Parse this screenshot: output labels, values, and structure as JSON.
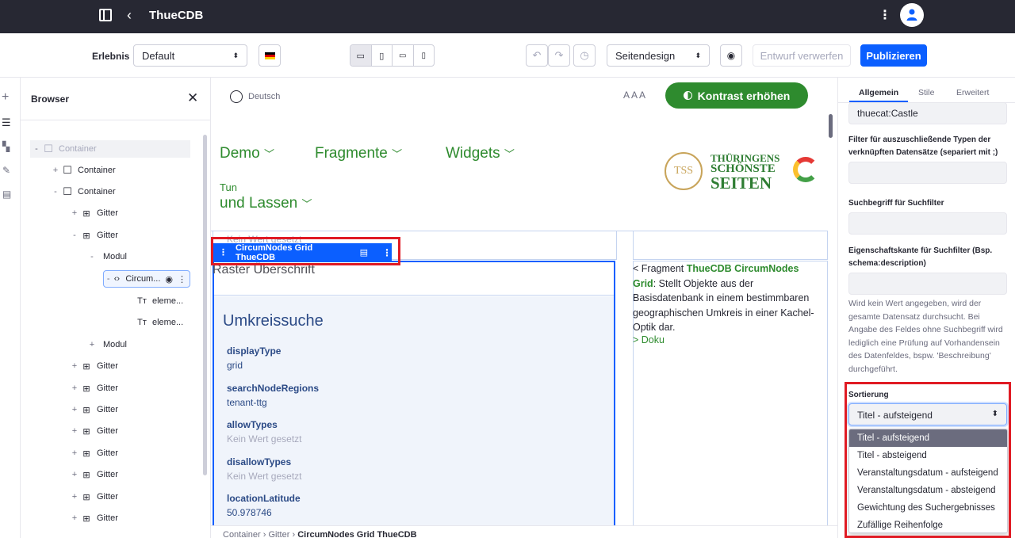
{
  "topbar": {
    "title": "ThueCDB"
  },
  "toolbar": {
    "experience_label": "Erlebnis",
    "experience_value": "Default",
    "design_value": "Seitendesign",
    "discard_label": "Entwurf verwerfen",
    "publish_label": "Publizieren"
  },
  "browser": {
    "title": "Browser",
    "items": [
      {
        "toggle": "-",
        "icon": "container-icon",
        "label": "Container"
      },
      {
        "toggle": "+",
        "icon": "container-icon",
        "label": "Container"
      },
      {
        "toggle": "-",
        "icon": "container-icon",
        "label": "Container"
      },
      {
        "toggle": "+",
        "icon": "grid-icon",
        "label": "Gitter"
      },
      {
        "toggle": "-",
        "icon": "grid-icon",
        "label": "Gitter"
      },
      {
        "toggle": "-",
        "icon": "",
        "label": "Modul"
      },
      {
        "toggle": "-",
        "icon": "code-icon",
        "label": "Circum..."
      },
      {
        "toggle": "",
        "icon": "text-icon",
        "label": "eleme..."
      },
      {
        "toggle": "",
        "icon": "text-icon",
        "label": "eleme..."
      },
      {
        "toggle": "+",
        "icon": "",
        "label": "Modul"
      },
      {
        "toggle": "+",
        "icon": "grid-icon",
        "label": "Gitter"
      },
      {
        "toggle": "+",
        "icon": "grid-icon",
        "label": "Gitter"
      },
      {
        "toggle": "+",
        "icon": "grid-icon",
        "label": "Gitter"
      },
      {
        "toggle": "+",
        "icon": "grid-icon",
        "label": "Gitter"
      },
      {
        "toggle": "+",
        "icon": "grid-icon",
        "label": "Gitter"
      },
      {
        "toggle": "+",
        "icon": "grid-icon",
        "label": "Gitter"
      },
      {
        "toggle": "+",
        "icon": "grid-icon",
        "label": "Gitter"
      },
      {
        "toggle": "+",
        "icon": "grid-icon",
        "label": "Gitter"
      }
    ]
  },
  "canvas": {
    "language": "Deutsch",
    "font_sizes": "A A A",
    "contrast_button": "Kontrast erhöhen",
    "nav": [
      "Demo",
      "Fragmente",
      "Widgets"
    ],
    "nav_second_small": "Tun",
    "nav_second": "und Lassen",
    "logo_text": [
      "THÜRINGENS",
      "SCHÖNSTE",
      "SEITEN"
    ],
    "logo_mark": "TSS",
    "top_placeholder": "Kein Wert gesetzt",
    "fragment_toolbar_label": "CircumNodes Grid ThueCDB",
    "raster_heading": "Raster Überschrift",
    "umkreis_heading": "Umkreissuche",
    "properties": [
      {
        "name": "displayType",
        "value": "grid",
        "empty": false
      },
      {
        "name": "searchNodeRegions",
        "value": "tenant-ttg",
        "empty": false
      },
      {
        "name": "allowTypes",
        "value": "Kein Wert gesetzt",
        "empty": true
      },
      {
        "name": "disallowTypes",
        "value": "Kein Wert gesetzt",
        "empty": true
      },
      {
        "name": "locationLatitude",
        "value": "50.978746",
        "empty": false
      }
    ],
    "description_prefix": "< Fragment ",
    "description_bold": "ThueCDB CircumNodes Grid",
    "description_rest": ": Stellt Objekte aus der Basisdatenbank in einem bestimmbaren geographischen Umkreis in einer Kachel-Optik dar.",
    "doku_link": "> Doku",
    "breadcrumb": [
      "Container",
      "Gitter",
      "CircumNodes Grid ThueCDB"
    ]
  },
  "rightpanel": {
    "tabs": [
      "Allgemein",
      "Stile",
      "Erweitert"
    ],
    "top_value": "thuecat:Castle",
    "filter_label": "Filter für auszuschließende Typen der verknüpften Datensätze (separiert mit ;)",
    "search_label": "Suchbegriff für Suchfilter",
    "property_label": "Eigenschaftskante für Suchfilter (Bsp. schema:description)",
    "help_text": "Wird kein Wert angegeben, wird der gesamte Datensatz durchsucht. Bei Angabe des Feldes ohne Suchbegriff wird lediglich eine Prüfung auf Vorhandensein des Datenfeldes, bspw. 'Beschreibung' durchgeführt.",
    "sort_label": "Sortierung",
    "sort_value": "Titel - aufsteigend",
    "sort_options": [
      "Titel - aufsteigend",
      "Titel - absteigend",
      "Veranstaltungsdatum - aufsteigend",
      "Veranstaltungsdatum - absteigend",
      "Gewichtung des Suchergebnisses",
      "Zufällige Reihenfolge"
    ]
  },
  "colors": {
    "accent": "#0b5fff",
    "green": "#2e8b2e",
    "highlight": "#e01b24",
    "dark": "#272833"
  }
}
